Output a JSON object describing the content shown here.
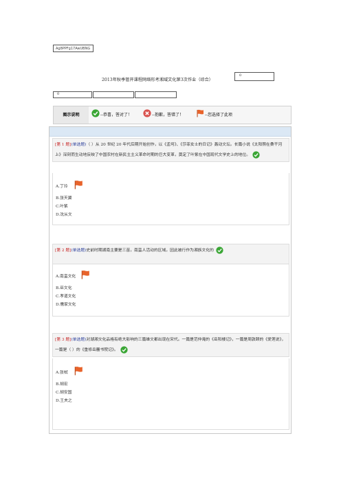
{
  "doc_code": "Ag8PPFg17AwUBNG",
  "title": "2013年秋季管开课程网络形考湘域文化第3次作业（综合）",
  "score_value": "0",
  "row_cells": [
    "0",
    "",
    ""
  ],
  "legend": {
    "heading": "图示说明",
    "correct_text": "--恭喜，答对了！",
    "wrong_text": "--抱歉，答错了！",
    "chosen_text": "--您选择了此项"
  },
  "colors": {
    "correct": "#3aa635",
    "wrong": "#d9534f",
    "flag": "#e8632b",
    "question_number": "#c62222",
    "question_type": "#2a3e9a"
  },
  "icons": {
    "correct": "check-circle-icon",
    "wrong": "x-circle-icon",
    "chosen": "flag-icon"
  },
  "questions": [
    {
      "number": "[第 1 题]",
      "type": "(单选题)",
      "stem": "（ ）从 20 世纪 20 年代后期开始创作，以《孟坷》、《莎菲女士的日记》轰动文坛。长篇小说《太阳照在桑干河上》深刻而生动地反映了中国农村在新民主主义革命时期的巨大变革，奠定了叶紫在中国现代文学史上的地位。",
      "options": [
        "A.丁玲",
        "B.张天翼",
        "C.叶紫",
        "D.沈从文"
      ]
    },
    {
      "number": "[第 2 题]",
      "type": "(单选题)",
      "stem": "史前时期湖南主要是三苗，南蛮人活动的区域，因此被行作为湘族文化的",
      "options": [
        "A.南蛮文化",
        "B.巫文化",
        "C.孝道文化",
        "D.儒家文化"
      ]
    },
    {
      "number": "[第 3 题]",
      "type": "(单选题)",
      "stem": "对湖湘文化品格有绝大影响的三篇雄文都出现在宋代。一篇是范仲淹的《岳阳楼记》，一篇是周敦颐的《爱莲说》，一篇是（ ）的《重修岳麓书院记》。",
      "options": [
        "A.张栻",
        "B.胡宏",
        "C.胡安国",
        "D.王夫之"
      ]
    }
  ]
}
